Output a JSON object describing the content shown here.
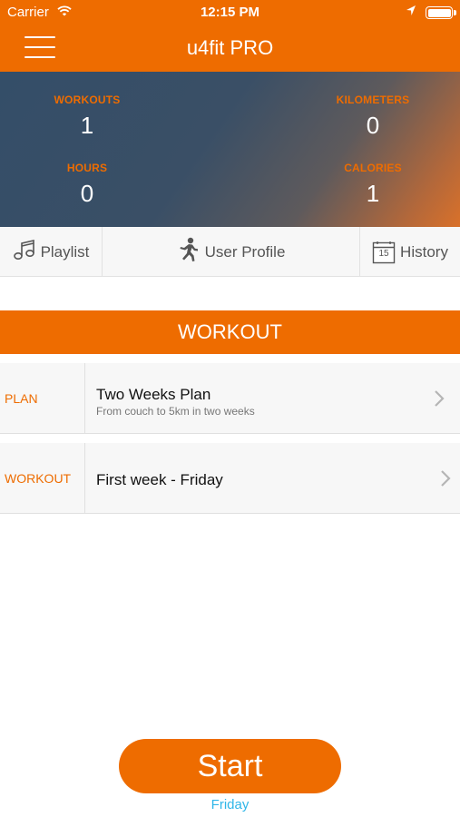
{
  "status_bar": {
    "carrier": "Carrier",
    "time": "12:15 PM"
  },
  "header": {
    "title": "u4fit PRO",
    "accent_color": "#ee6c00"
  },
  "stats": {
    "workouts": {
      "label": "WORKOUTS",
      "value": "1"
    },
    "kilometers": {
      "label": "KILOMETERS",
      "value": "0"
    },
    "hours": {
      "label": "HOURS",
      "value": "0"
    },
    "calories": {
      "label": "CALORIES",
      "value": "1"
    }
  },
  "tabs": {
    "playlist": "Playlist",
    "user_profile": "User Profile",
    "history": "History",
    "history_calendar_day": "15"
  },
  "workout_section": {
    "title": "WORKOUT",
    "plan_row": {
      "label": "PLAN",
      "title": "Two Weeks Plan",
      "subtitle": "From couch to 5km in two weeks"
    },
    "workout_row": {
      "label": "WORKOUT",
      "title": "First week - Friday"
    }
  },
  "start": {
    "label": "Start",
    "day": "Friday",
    "day_color": "#2fb6e8"
  }
}
